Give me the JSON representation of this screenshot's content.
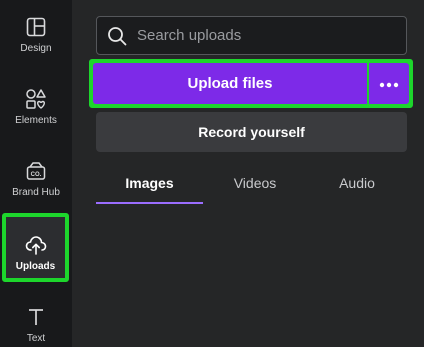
{
  "rail": {
    "items": [
      {
        "label": "Design",
        "icon": "layout-icon"
      },
      {
        "label": "Elements",
        "icon": "shapes-icon"
      },
      {
        "label": "Brand Hub",
        "icon": "brand-hub-icon"
      },
      {
        "label": "Uploads",
        "icon": "cloud-upload-icon",
        "active": true
      },
      {
        "label": "Text",
        "icon": "text-icon"
      }
    ]
  },
  "search": {
    "placeholder": "Search uploads",
    "value": ""
  },
  "upload": {
    "label": "Upload files",
    "more_icon": "more-horizontal-icon"
  },
  "record": {
    "label": "Record yourself"
  },
  "tabs": [
    {
      "label": "Images",
      "active": true
    },
    {
      "label": "Videos"
    },
    {
      "label": "Audio"
    }
  ],
  "colors": {
    "accent": "#7d2ae8",
    "highlight": "#1dd62c",
    "tab_underline": "#9b6dff",
    "panel_bg": "#252627",
    "rail_bg": "#18191b"
  }
}
